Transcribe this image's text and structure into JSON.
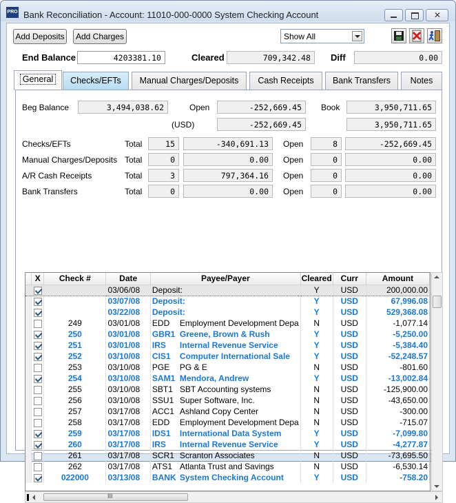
{
  "window": {
    "app_icon": "PRO",
    "title": "Bank Reconciliation - Account: 11010-000-0000 System Checking Account"
  },
  "toolbar": {
    "add_deposits": "Add Deposits",
    "add_charges": "Add Charges",
    "filter_value": "Show All",
    "save_icon": "floppy-disk-icon",
    "delete_icon": "cancel-document-icon",
    "exit_icon": "exit-door-icon"
  },
  "summary": {
    "end_balance_label": "End Balance",
    "end_balance_value": "4203381.10",
    "cleared_label": "Cleared",
    "cleared_value": "709,342.48",
    "diff_label": "Diff",
    "diff_value": "0.00"
  },
  "tabs": [
    {
      "label": "General"
    },
    {
      "label": "Checks/EFTs"
    },
    {
      "label": "Manual Charges/Deposits"
    },
    {
      "label": "Cash Receipts"
    },
    {
      "label": "Bank Transfers"
    },
    {
      "label": "Notes"
    }
  ],
  "general": {
    "beg_balance_label": "Beg Balance",
    "beg_balance_value": "3,494,038.62",
    "open_label": "Open",
    "open_value": "-252,669.45",
    "book_label": "Book",
    "book_value": "3,950,711.65",
    "usd_label": "(USD)",
    "usd_open_value": "-252,669.45",
    "usd_book_value": "3,950,711.65",
    "total_label": "Total",
    "rows": [
      {
        "label": "Checks/EFTs",
        "total_count": "15",
        "total_amount": "-340,691.13",
        "open_count": "8",
        "open_amount": "-252,669.45"
      },
      {
        "label": "Manual Charges/Deposits",
        "total_count": "0",
        "total_amount": "0.00",
        "open_count": "0",
        "open_amount": "0.00"
      },
      {
        "label": "A/R Cash Receipts",
        "total_count": "3",
        "total_amount": "797,364.16",
        "open_count": "0",
        "open_amount": "0.00"
      },
      {
        "label": "Bank Transfers",
        "total_count": "0",
        "total_amount": "0.00",
        "open_count": "0",
        "open_amount": "0.00"
      }
    ]
  },
  "grid": {
    "columns": [
      "X",
      "Check #",
      "Date",
      "Payee/Payer",
      "Cleared",
      "Curr",
      "Amount"
    ],
    "rows": [
      {
        "checked": true,
        "check": "",
        "date": "03/06/08",
        "code": "Deposit:",
        "name": "",
        "cleared": "Y",
        "curr": "USD",
        "amount": "200,000.00",
        "style": "sel"
      },
      {
        "checked": true,
        "check": "",
        "date": "03/07/08",
        "code": "Deposit:",
        "name": "",
        "cleared": "Y",
        "curr": "USD",
        "amount": "67,996.08",
        "style": "blue"
      },
      {
        "checked": true,
        "check": "",
        "date": "03/22/08",
        "code": "Deposit:",
        "name": "",
        "cleared": "Y",
        "curr": "USD",
        "amount": "529,368.08",
        "style": "blue"
      },
      {
        "checked": false,
        "check": "249",
        "date": "03/01/08",
        "code": "EDD",
        "name": "Employment Development Depa",
        "cleared": "N",
        "curr": "USD",
        "amount": "-1,077.14",
        "style": ""
      },
      {
        "checked": true,
        "check": "250",
        "date": "03/01/08",
        "code": "GBR1",
        "name": "Greene, Brown & Rush",
        "cleared": "Y",
        "curr": "USD",
        "amount": "-5,250.00",
        "style": "blue"
      },
      {
        "checked": true,
        "check": "251",
        "date": "03/01/08",
        "code": "IRS",
        "name": "Internal Revenue Service",
        "cleared": "Y",
        "curr": "USD",
        "amount": "-5,384.40",
        "style": "blue"
      },
      {
        "checked": true,
        "check": "252",
        "date": "03/10/08",
        "code": "CIS1",
        "name": "Computer International Sale",
        "cleared": "Y",
        "curr": "USD",
        "amount": "-52,248.57",
        "style": "blue"
      },
      {
        "checked": false,
        "check": "253",
        "date": "03/10/08",
        "code": "PGE",
        "name": "PG & E",
        "cleared": "N",
        "curr": "USD",
        "amount": "-801.60",
        "style": ""
      },
      {
        "checked": true,
        "check": "254",
        "date": "03/10/08",
        "code": "SAM1",
        "name": "Mendora, Andrew",
        "cleared": "Y",
        "curr": "USD",
        "amount": "-13,002.84",
        "style": "blue"
      },
      {
        "checked": false,
        "check": "255",
        "date": "03/10/08",
        "code": "SBT1",
        "name": "SBT Accounting systems",
        "cleared": "N",
        "curr": "USD",
        "amount": "-125,900.00",
        "style": ""
      },
      {
        "checked": false,
        "check": "256",
        "date": "03/10/08",
        "code": "SSU1",
        "name": "Super Software, Inc.",
        "cleared": "N",
        "curr": "USD",
        "amount": "-43,650.00",
        "style": ""
      },
      {
        "checked": false,
        "check": "257",
        "date": "03/17/08",
        "code": "ACC1",
        "name": "Ashland Copy Center",
        "cleared": "N",
        "curr": "USD",
        "amount": "-300.00",
        "style": ""
      },
      {
        "checked": false,
        "check": "258",
        "date": "03/17/08",
        "code": "EDD",
        "name": "Employment Development Depa",
        "cleared": "N",
        "curr": "USD",
        "amount": "-715.07",
        "style": ""
      },
      {
        "checked": true,
        "check": "259",
        "date": "03/17/08",
        "code": "IDS1",
        "name": "International Data System",
        "cleared": "Y",
        "curr": "USD",
        "amount": "-7,099.80",
        "style": "blue"
      },
      {
        "checked": true,
        "check": "260",
        "date": "03/17/08",
        "code": "IRS",
        "name": "Internal Revenue Service",
        "cleared": "Y",
        "curr": "USD",
        "amount": "-4,277.87",
        "style": "blue"
      },
      {
        "checked": false,
        "check": "261",
        "date": "03/17/08",
        "code": "SCR1",
        "name": "Scranton Associates",
        "cleared": "N",
        "curr": "USD",
        "amount": "-73,695.50",
        "style": ""
      },
      {
        "checked": false,
        "check": "262",
        "date": "03/17/08",
        "code": "ATS1",
        "name": "Atlanta Trust and Savings",
        "cleared": "N",
        "curr": "USD",
        "amount": "-6,530.14",
        "style": ""
      },
      {
        "checked": true,
        "check": "022000",
        "date": "03/13/08",
        "code": "BANK",
        "name": "System Checking Account",
        "cleared": "Y",
        "curr": "USD",
        "amount": "-758.20",
        "style": "blue"
      }
    ]
  },
  "scrollbar": {
    "grip": "III"
  }
}
